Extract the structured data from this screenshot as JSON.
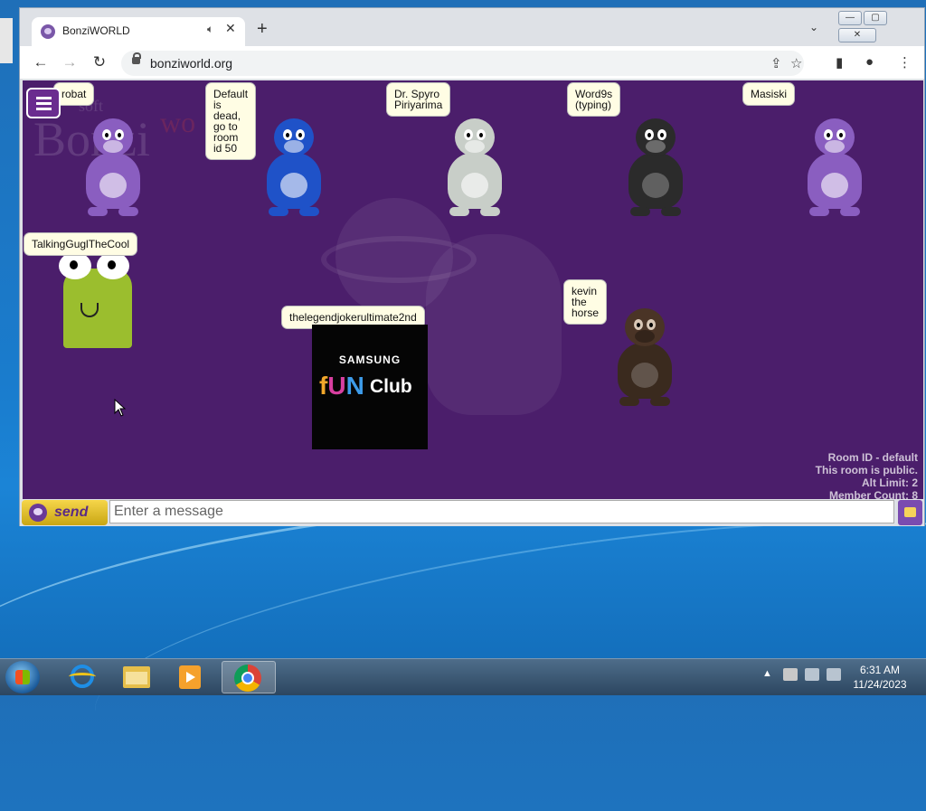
{
  "browser": {
    "tab_title": "BonziWORLD",
    "audio_icon": "speaker-icon",
    "close_glyph": "✕",
    "newtab_glyph": "+",
    "tab_search_glyph": "⌄",
    "url": "bonziworld.org",
    "window_buttons": [
      "—",
      "▢",
      "✕"
    ],
    "nav": {
      "back": "←",
      "forward": "→",
      "reload": "↻"
    },
    "omnibox_icons": {
      "share": "⇪",
      "bookmark": "☆"
    },
    "toolbar_icons": {
      "sidepanel": "▮",
      "profile": "●",
      "menu": "⋮"
    }
  },
  "page": {
    "bg_logo": {
      "microsoft": "soft",
      "bonzi": "Bonzi",
      "world": "wo"
    },
    "users": [
      {
        "name": "robat",
        "color": "#8a5ec0"
      },
      {
        "name": "Default is dead, go to room id 50",
        "lines": [
          "Default",
          "is",
          "dead,",
          "go to",
          "room",
          "id 50"
        ],
        "color": "#1f52c8"
      },
      {
        "name": "Dr. Spyro Piriyarima",
        "lines": [
          "Dr. Spyro",
          "Piriyarima"
        ],
        "color": "#c8cec8"
      },
      {
        "name": "Word9s (typing)",
        "lines": [
          "Word9s",
          "(typing)"
        ],
        "color": "#2b2b2b"
      },
      {
        "name": "Masiski",
        "color": "#8a5ec0"
      },
      {
        "name": "TalkingGuglTheCool",
        "color": "#9bbe2e"
      },
      {
        "name": "thelegendjokerultimate2nd",
        "color": "#050505"
      },
      {
        "name": "kevin the horse",
        "lines": [
          "kevin",
          "the",
          "horse"
        ],
        "color": "#3a2a1e"
      }
    ],
    "samsung": {
      "brand": "SAMSUNG",
      "fun_f": "f",
      "fun_u": "U",
      "fun_n": "N",
      "club": "Club"
    },
    "room_info": [
      "Room ID - default",
      "This room is public.",
      "Alt Limit: 2",
      "Member Count: 8"
    ],
    "chat": {
      "send_label": "send",
      "placeholder": "Enter a message"
    }
  },
  "taskbar": {
    "apps": [
      "Internet Explorer",
      "Windows Explorer",
      "Windows Media Player",
      "Google Chrome"
    ],
    "active_app": "Google Chrome",
    "tray_arrow": "▲",
    "time": "6:31 AM",
    "date": "11/24/2023"
  }
}
